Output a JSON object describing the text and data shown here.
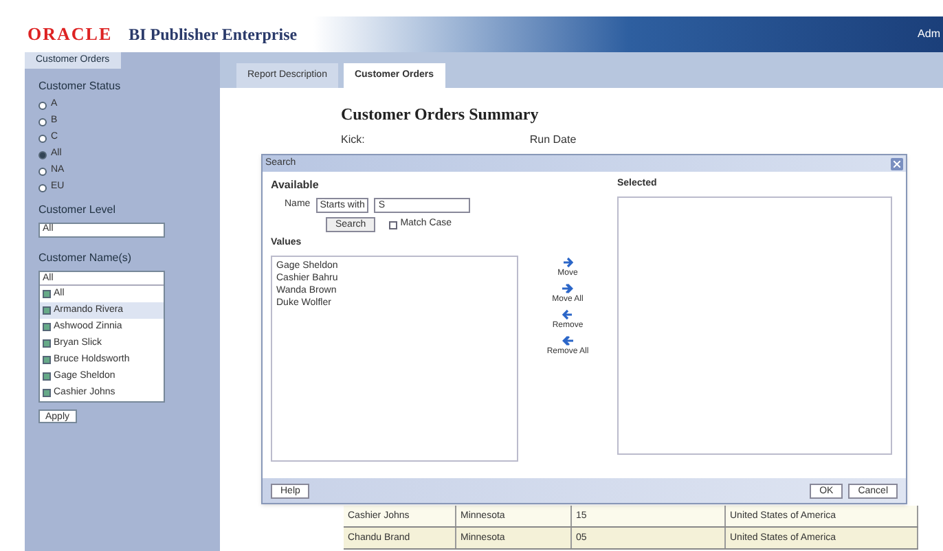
{
  "header": {
    "logo": "ORACLE",
    "product": "BI Publisher Enterprise",
    "user": "Adm"
  },
  "sidebar": {
    "tab": "Customer Orders",
    "status_label": "Customer Status",
    "status_options": [
      {
        "label": "A",
        "selected": false
      },
      {
        "label": "B",
        "selected": false
      },
      {
        "label": "C",
        "selected": false
      },
      {
        "label": "All",
        "selected": true
      },
      {
        "label": "NA",
        "selected": false
      },
      {
        "label": "EU",
        "selected": false
      }
    ],
    "level_label": "Customer Level",
    "level_value": "All",
    "name_label": "Customer Name(s)",
    "name_value": "All",
    "names": [
      {
        "label": "All",
        "checked": true
      },
      {
        "label": "Armando Rivera",
        "checked": true,
        "selected": true
      },
      {
        "label": "Ashwood Zinnia",
        "checked": true,
        "selected": false
      },
      {
        "label": "Bryan Slick",
        "checked": true,
        "selected": false
      },
      {
        "label": "Bruce Holdsworth",
        "checked": true,
        "selected": false
      },
      {
        "label": "Gage Sheldon",
        "checked": true,
        "selected": false
      },
      {
        "label": "Cashier Johns",
        "checked": true,
        "selected": false
      }
    ],
    "apply": "Apply"
  },
  "report_tabs": [
    {
      "label": "Report Description",
      "selected": false
    },
    {
      "label": "Customer Orders",
      "selected": true
    }
  ],
  "report": {
    "title": "Customer Orders Summary",
    "field_label": "Kick:",
    "field_label_2": "Run Date",
    "rows": [
      [
        "Cashier Johns",
        "Minnesota",
        "15",
        "United States of America"
      ],
      [
        "Chandu Brand",
        "Minnesota",
        "05",
        "United States of America"
      ]
    ]
  },
  "dialog": {
    "title": "Search",
    "available": "Available",
    "name_label": "Name",
    "operator": "Starts with",
    "search_value": "S",
    "search_button": "Search",
    "match_case": {
      "label": "Match Case",
      "checked": false
    },
    "values_label": "Values",
    "values": [
      "Gage Sheldon",
      "Cashier Bahru",
      "Wanda Brown",
      "Duke Wolfler"
    ],
    "moves": [
      {
        "kind": "move",
        "label": "Move"
      },
      {
        "kind": "move_all",
        "label": "Move All"
      },
      {
        "kind": "remove",
        "label": "Remove"
      },
      {
        "kind": "remove_all",
        "label": "Remove All"
      }
    ],
    "selected_label": "Selected",
    "help": "Help",
    "ok": "OK",
    "cancel": "Cancel"
  }
}
